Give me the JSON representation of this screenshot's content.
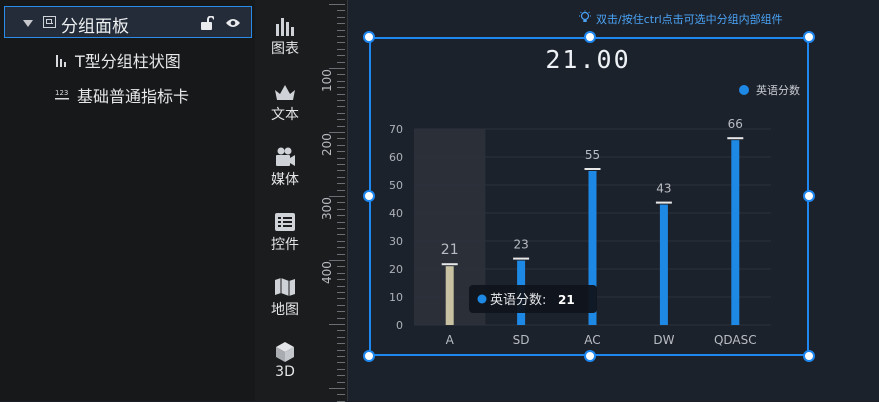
{
  "layers": {
    "group": {
      "label": "分组面板"
    },
    "children": [
      {
        "label": "T型分组柱状图",
        "icon": "bar-chart-icon"
      },
      {
        "label": "基础普通指标卡",
        "icon": "number-card-icon"
      }
    ]
  },
  "toolbar": {
    "items": [
      {
        "label": "图表",
        "icon": "chart-icon"
      },
      {
        "label": "文本",
        "icon": "text-icon"
      },
      {
        "label": "媒体",
        "icon": "camera-icon"
      },
      {
        "label": "控件",
        "icon": "widget-icon"
      },
      {
        "label": "地图",
        "icon": "map-icon"
      },
      {
        "label": "3D",
        "icon": "cube-icon"
      }
    ]
  },
  "ruler": {
    "labels": [
      "100",
      "200",
      "300",
      "400"
    ]
  },
  "canvas": {
    "hint": "双击/按住ctrl点击可选中分组内部组件",
    "indicator_value": "21.00"
  },
  "chart_data": {
    "type": "bar",
    "categories": [
      "A",
      "SD",
      "AC",
      "DW",
      "QDASC"
    ],
    "series": [
      {
        "name": "英语分数",
        "values": [
          21,
          23,
          55,
          43,
          66
        ]
      }
    ],
    "ylim": [
      0,
      70
    ],
    "yticks": [
      0,
      10,
      20,
      30,
      40,
      50,
      60,
      70
    ],
    "legend_position": "top-right",
    "grid": true,
    "highlighted_category": "A",
    "tooltip": {
      "label": "英语分数:",
      "value": "21"
    },
    "colors": {
      "bar": "#1e88e5",
      "highlight": "#c9c2a2",
      "grid": "#2c323c"
    }
  }
}
